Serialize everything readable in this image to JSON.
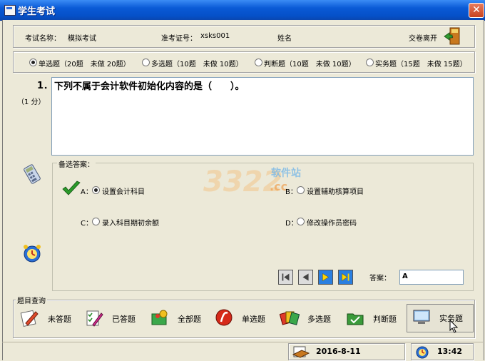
{
  "window": {
    "title": "学生考试",
    "close": "✕"
  },
  "info": {
    "exam_name_label": "考试名称：",
    "exam_name": "模拟考试",
    "ticket_label": "准考证号：",
    "ticket": "xsks001",
    "name_label": "姓名",
    "submit_label": "交卷离开",
    "exit_icon": "exit-door-icon"
  },
  "types": [
    {
      "label": "单选题（20题　未做 20题）",
      "selected": true
    },
    {
      "label": "多选题（10题　未做 10题）",
      "selected": false
    },
    {
      "label": "判断题（10题　未做 10题）",
      "selected": false
    },
    {
      "label": "实务题（15题　未做 15题）",
      "selected": false
    }
  ],
  "question": {
    "number": "1．",
    "score": "（1 分）",
    "text": "下列不属于会计软件初始化内容的是（　　）。"
  },
  "answers": {
    "title": "备选答案：",
    "options": [
      {
        "key": "A：",
        "text": "设置会计科目",
        "selected": true
      },
      {
        "key": "B：",
        "text": "设置辅助核算项目",
        "selected": false
      },
      {
        "key": "C：",
        "text": "录入科目期初余额",
        "selected": false
      },
      {
        "key": "D：",
        "text": "修改操作员密码",
        "selected": false
      }
    ],
    "answer_label": "答案：",
    "answer_value": "A"
  },
  "watermark": {
    "text": "3322",
    "cn": "软件站",
    "suffix": ".cc"
  },
  "query": {
    "title": "题目查询",
    "buttons": [
      {
        "label": "未答题",
        "icon": "pencil-paper-icon"
      },
      {
        "label": "已答题",
        "icon": "pen-checklist-icon"
      },
      {
        "label": "全部题",
        "icon": "colorful-book-icon"
      },
      {
        "label": "单选题",
        "icon": "red-disc-icon"
      },
      {
        "label": "多选题",
        "icon": "cards-icon"
      },
      {
        "label": "判断题",
        "icon": "green-folder-icon"
      },
      {
        "label": "实务题",
        "icon": "monitor-icon"
      }
    ]
  },
  "status": {
    "date": "2016-8-11",
    "time": "13:42"
  },
  "colors": {
    "titlebar": "#0a5ad6",
    "nav_blue": "#2a7fe0",
    "check_green": "#2a9a2a"
  }
}
